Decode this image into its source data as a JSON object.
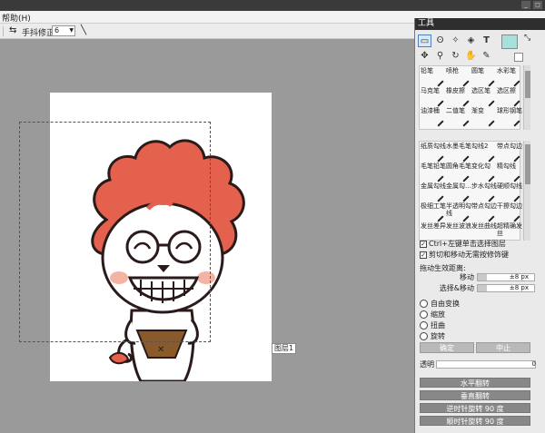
{
  "menubar": {
    "help": "帮助(H)"
  },
  "window_buttons": [
    "_",
    "◻"
  ],
  "toolbar": {
    "stabilizer_label": "手抖修正",
    "stabilizer_value": "6"
  },
  "canvas": {
    "layer_tag": "图层1"
  },
  "panel": {
    "title": "工具",
    "brushes_top": [
      [
        "铅笔",
        "喷枪",
        "圆笔",
        "水彩笔"
      ],
      [
        "马克笔",
        "橡皮擦",
        "选区笔",
        "选区擦"
      ],
      [
        "油漆桶",
        "二值笔",
        "渐变",
        "球形钢笔"
      ]
    ],
    "brushes_bottom": [
      [
        "纸质勾线",
        "水墨毛笔",
        "勾线2",
        "带点勾边"
      ],
      [
        "毛笔铅笔",
        "圆角毛笔",
        "变化勾",
        "精勾线"
      ],
      [
        "金属勾线",
        "金属勾…",
        "步水勾线",
        "硬顺勾线"
      ],
      [
        "极细工笔",
        "半透明勾线",
        "带点勾边",
        "干擦勾边"
      ],
      [
        "发丝差异",
        "发丝波浪",
        "发丝曲线",
        "超精确发丝"
      ]
    ],
    "check1": "Ctrl+左键单击选择图层",
    "check2": "剪切和移动无需按修饰键",
    "drag_label": "拖动生效距离:",
    "move_label": "移动",
    "move_value": "±8 px",
    "select_move_label": "选择&移动",
    "select_move_value": "±8 px",
    "transforms": [
      "自由变换",
      "缩放",
      "扭曲",
      "旋转"
    ],
    "ok": "确定",
    "cancel": "中止",
    "opacity_label": "透明",
    "opacity_value": "0",
    "flip_h": "水平翻转",
    "flip_v": "垂直翻转",
    "rotate_ccw": "逆时针旋转 90 度",
    "rotate_cw": "顺时针旋转 90 度"
  },
  "colors": {
    "accent_swatch": "#a8e0dc",
    "lion_mane": "#e4614e",
    "panel_dark": "#2e2e2e"
  }
}
